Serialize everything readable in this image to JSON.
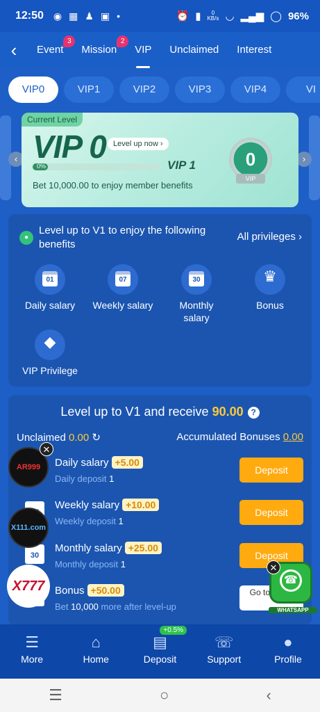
{
  "status": {
    "time": "12:50",
    "battery": "96%",
    "speed": "0",
    "speed_unit": "KB/s"
  },
  "nav": {
    "tabs": [
      {
        "label": "Event",
        "badge": "3"
      },
      {
        "label": "Mission",
        "badge": "2"
      },
      {
        "label": "VIP"
      },
      {
        "label": "Unclaimed"
      },
      {
        "label": "Interest"
      }
    ]
  },
  "vip_levels": [
    "VIP0",
    "VIP1",
    "VIP2",
    "VIP3",
    "VIP4",
    "VI"
  ],
  "level_card": {
    "current_label": "Current Level",
    "level": "VIP 0",
    "level_up": "Level up now",
    "progress_text": "0%",
    "progress": 0.12,
    "next_level": "VIP 1",
    "bet_prefix": "Bet",
    "bet_amount": "10,000.00",
    "bet_suffix": "to enjoy member benefits",
    "medal_value": "0",
    "medal_tag": "VIP"
  },
  "benefits": {
    "heading": "Level up to V1 to enjoy the following benefits",
    "all_label": "All privileges",
    "items": [
      {
        "label": "Daily salary",
        "icon": "calendar-01-icon",
        "day": "01"
      },
      {
        "label": "Weekly salary",
        "icon": "calendar-07-icon",
        "day": "07"
      },
      {
        "label": "Monthly salary",
        "icon": "calendar-30-icon",
        "day": "30"
      },
      {
        "label": "Bonus",
        "icon": "trophy-icon"
      },
      {
        "label": "VIP Privilege",
        "icon": "diamond-icon"
      }
    ]
  },
  "receive": {
    "title_prefix": "Level up to V1 and receive",
    "title_amount": "90.00",
    "unclaimed_label": "Unclaimed",
    "unclaimed_value": "0.00",
    "accumulated_label": "Accumulated Bonuses",
    "accumulated_value": "0.00",
    "rows": [
      {
        "name": "Daily salary",
        "amount": "+5.00",
        "sub_label": "Daily deposit",
        "sub_value": "1",
        "button": "Deposit"
      },
      {
        "name": "Weekly salary",
        "amount": "+10.00",
        "sub_label": "Weekly deposit",
        "sub_value": "1",
        "button": "Deposit"
      },
      {
        "name": "Monthly salary",
        "amount": "+25.00",
        "sub_label": "Monthly deposit",
        "sub_value": "1",
        "button": "Deposit"
      },
      {
        "name": "Bonus",
        "amount": "+50.00",
        "sub_label": "Bet",
        "sub_value": "10,000",
        "sub_suffix": "more after level-up",
        "button": "Go to game"
      }
    ]
  },
  "floating": {
    "ad1": "AR999",
    "ad2": "X111.com",
    "ad3": "X777",
    "whatsapp": "WHATSAPP"
  },
  "bottom_nav": [
    {
      "label": "More"
    },
    {
      "label": "Home"
    },
    {
      "label": "Deposit",
      "tag": "+0.5%"
    },
    {
      "label": "Support"
    },
    {
      "label": "Profile"
    }
  ]
}
